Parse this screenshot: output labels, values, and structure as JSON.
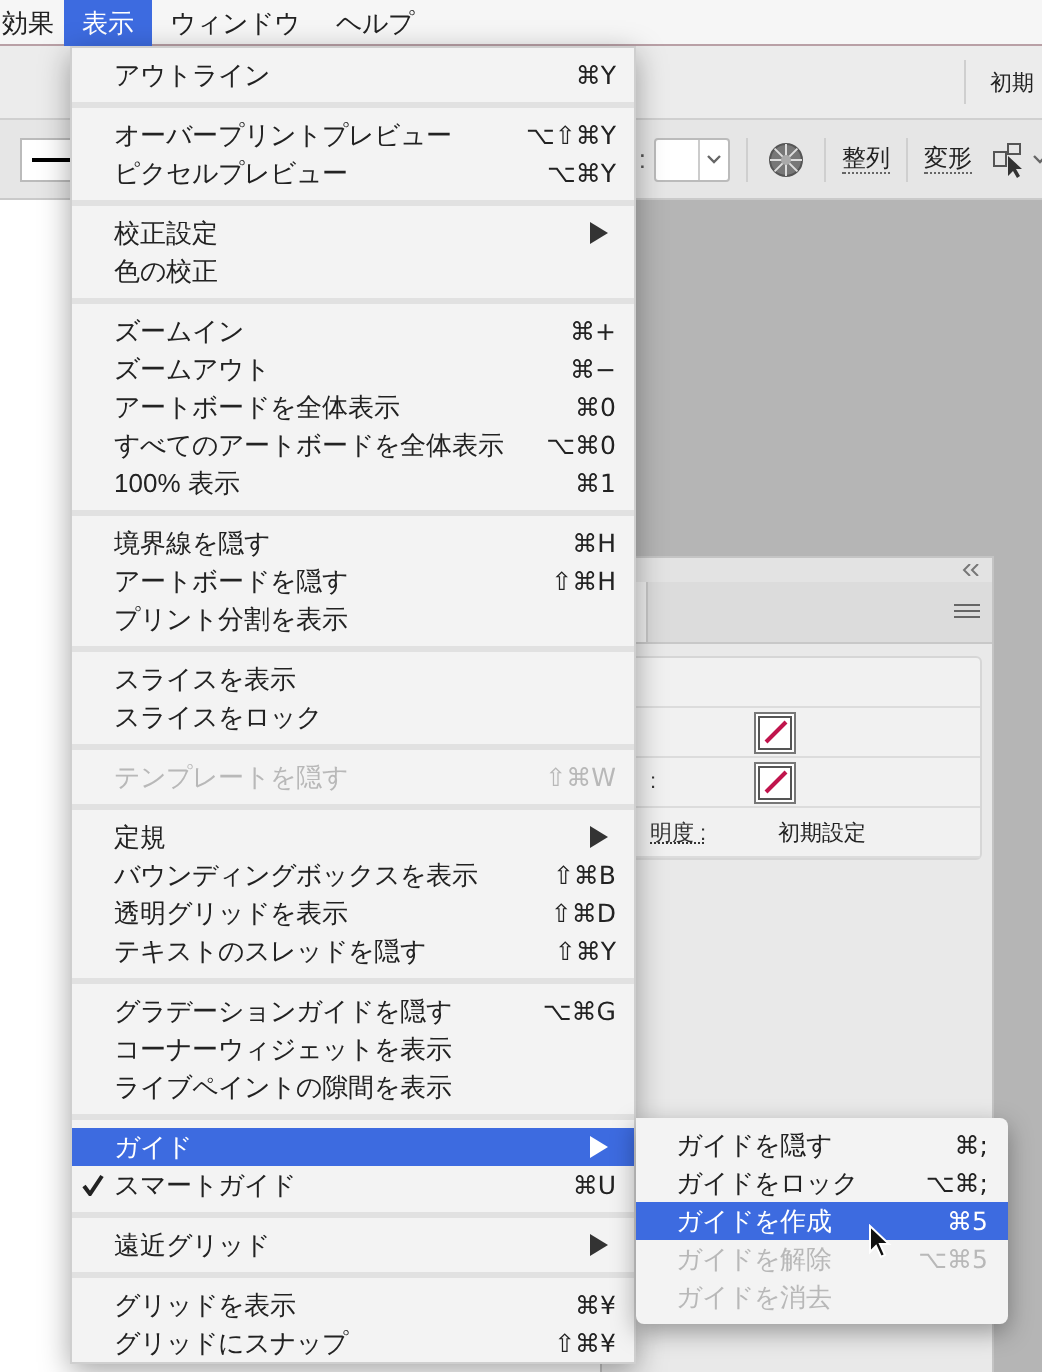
{
  "menubar": [
    {
      "label": "効果",
      "selected": false
    },
    {
      "label": "表示",
      "selected": true
    },
    {
      "label": "ウィンドウ",
      "selected": false
    },
    {
      "label": "ヘルプ",
      "selected": false
    }
  ],
  "control_bar": {
    "preset": "初期",
    "colon": ":",
    "align_link": "整列",
    "transform_link": "変形"
  },
  "view_menu": [
    [
      {
        "label": "アウトライン",
        "shortcut": "⌘Y",
        "submenu": false,
        "disabled": false,
        "checked": false,
        "selected": false
      }
    ],
    [
      {
        "label": "オーバープリントプレビュー",
        "shortcut": "⌥⇧⌘Y",
        "submenu": false,
        "disabled": false,
        "checked": false,
        "selected": false
      },
      {
        "label": "ピクセルプレビュー",
        "shortcut": "⌥⌘Y",
        "submenu": false,
        "disabled": false,
        "checked": false,
        "selected": false
      }
    ],
    [
      {
        "label": "校正設定",
        "submenu": true,
        "disabled": false,
        "checked": false,
        "selected": false
      },
      {
        "label": "色の校正",
        "submenu": false,
        "disabled": false,
        "checked": false,
        "selected": false
      }
    ],
    [
      {
        "label": "ズームイン",
        "shortcut": "⌘+",
        "submenu": false,
        "disabled": false,
        "checked": false,
        "selected": false
      },
      {
        "label": "ズームアウト",
        "shortcut": "⌘−",
        "submenu": false,
        "disabled": false,
        "checked": false,
        "selected": false
      },
      {
        "label": "アートボードを全体表示",
        "shortcut": "⌘0",
        "submenu": false,
        "disabled": false,
        "checked": false,
        "selected": false
      },
      {
        "label": "すべてのアートボードを全体表示",
        "shortcut": "⌥⌘0",
        "submenu": false,
        "disabled": false,
        "checked": false,
        "selected": false
      },
      {
        "label": "100% 表示",
        "shortcut": "⌘1",
        "submenu": false,
        "disabled": false,
        "checked": false,
        "selected": false
      }
    ],
    [
      {
        "label": "境界線を隠す",
        "shortcut": "⌘H",
        "submenu": false,
        "disabled": false,
        "checked": false,
        "selected": false
      },
      {
        "label": "アートボードを隠す",
        "shortcut": "⇧⌘H",
        "submenu": false,
        "disabled": false,
        "checked": false,
        "selected": false
      },
      {
        "label": "プリント分割を表示",
        "submenu": false,
        "disabled": false,
        "checked": false,
        "selected": false
      }
    ],
    [
      {
        "label": "スライスを表示",
        "submenu": false,
        "disabled": false,
        "checked": false,
        "selected": false
      },
      {
        "label": "スライスをロック",
        "submenu": false,
        "disabled": false,
        "checked": false,
        "selected": false
      }
    ],
    [
      {
        "label": "テンプレートを隠す",
        "shortcut": "⇧⌘W",
        "submenu": false,
        "disabled": true,
        "checked": false,
        "selected": false
      }
    ],
    [
      {
        "label": "定規",
        "submenu": true,
        "disabled": false,
        "checked": false,
        "selected": false
      },
      {
        "label": "バウンディングボックスを表示",
        "shortcut": "⇧⌘B",
        "submenu": false,
        "disabled": false,
        "checked": false,
        "selected": false
      },
      {
        "label": "透明グリッドを表示",
        "shortcut": "⇧⌘D",
        "submenu": false,
        "disabled": false,
        "checked": false,
        "selected": false
      },
      {
        "label": "テキストのスレッドを隠す",
        "shortcut": "⇧⌘Y",
        "submenu": false,
        "disabled": false,
        "checked": false,
        "selected": false
      }
    ],
    [
      {
        "label": "グラデーションガイドを隠す",
        "shortcut": "⌥⌘G",
        "submenu": false,
        "disabled": false,
        "checked": false,
        "selected": false
      },
      {
        "label": "コーナーウィジェットを表示",
        "submenu": false,
        "disabled": false,
        "checked": false,
        "selected": false
      },
      {
        "label": "ライブペイントの隙間を表示",
        "submenu": false,
        "disabled": false,
        "checked": false,
        "selected": false
      }
    ],
    [
      {
        "label": "ガイド",
        "submenu": true,
        "disabled": false,
        "checked": false,
        "selected": true
      },
      {
        "label": "スマートガイド",
        "shortcut": "⌘U",
        "submenu": false,
        "disabled": false,
        "checked": true,
        "selected": false
      }
    ],
    [
      {
        "label": "遠近グリッド",
        "submenu": true,
        "disabled": false,
        "checked": false,
        "selected": false
      }
    ],
    [
      {
        "label": "グリッドを表示",
        "shortcut": "⌘¥",
        "submenu": false,
        "disabled": false,
        "checked": false,
        "selected": false
      },
      {
        "label": "グリッドにスナップ",
        "shortcut": "⇧⌘¥",
        "submenu": false,
        "disabled": false,
        "checked": false,
        "selected": false
      }
    ]
  ],
  "guide_submenu": [
    {
      "label": "ガイドを隠す",
      "shortcut": "⌘;",
      "disabled": false,
      "selected": false
    },
    {
      "label": "ガイドをロック",
      "shortcut": "⌥⌘;",
      "disabled": false,
      "selected": false
    },
    {
      "label": "ガイドを作成",
      "shortcut": "⌘5",
      "disabled": false,
      "selected": true
    },
    {
      "label": "ガイドを解除",
      "shortcut": "⌥⌘5",
      "disabled": true,
      "selected": false
    },
    {
      "label": "ガイドを消去",
      "disabled": true,
      "selected": false
    }
  ],
  "panel": {
    "rows": [
      {
        "kind": "blank"
      },
      {
        "kind": "swatch"
      },
      {
        "kind": "swatch",
        "label": ":"
      },
      {
        "kind": "text",
        "label": "明度 :",
        "value": "初期設定"
      }
    ]
  }
}
